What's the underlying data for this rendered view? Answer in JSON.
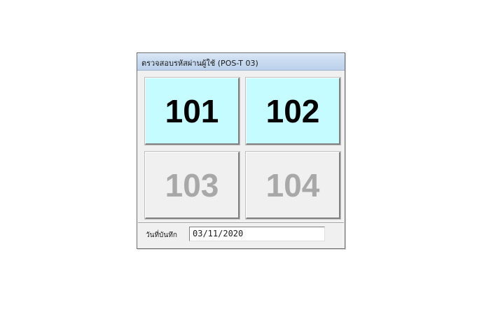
{
  "window": {
    "title": "ตรวจสอบรหัสผ่านผู้ใช้  (POS-T 03)"
  },
  "tiles": [
    {
      "label": "101",
      "state": "enabled",
      "background": "#c4fcff"
    },
    {
      "label": "102",
      "state": "enabled",
      "background": "#c4fcff"
    },
    {
      "label": "103",
      "state": "disabled",
      "background": "#f0f0f0"
    },
    {
      "label": "104",
      "state": "disabled",
      "background": "#f0f0f0"
    }
  ],
  "date": {
    "label": "วันที่บันทึก",
    "value": "03/11/2020"
  }
}
